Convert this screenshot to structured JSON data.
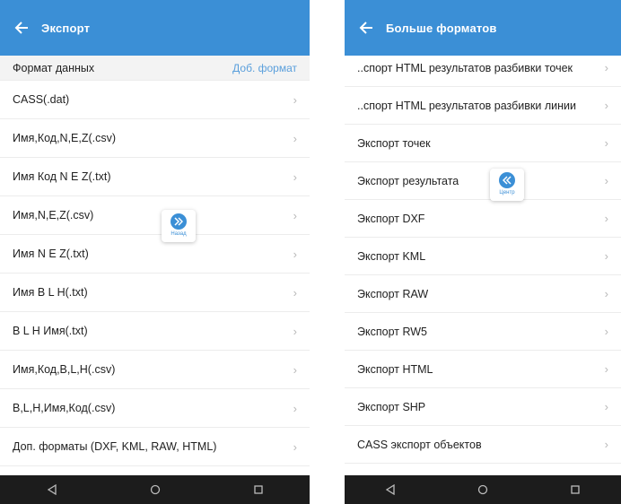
{
  "left": {
    "title": "Экспорт",
    "header": {
      "label": "Формат данных",
      "link": "Доб. формат"
    },
    "items": [
      "CASS(.dat)",
      "Имя,Код,N,E,Z(.csv)",
      "Имя Код N E Z(.txt)",
      "Имя,N,E,Z(.csv)",
      "Имя N E Z(.txt)",
      "Имя B L H(.txt)",
      "B L H Имя(.txt)",
      "Имя,Код,B,L,H(.csv)",
      "B,L,H,Имя,Код(.csv)",
      "Доп. форматы (DXF, KML, RAW, HTML)"
    ],
    "float_caption": "Назад"
  },
  "right": {
    "title": "Больше форматов",
    "items": [
      "..спорт HTML результатов разбивки точек",
      "..спорт HTML результатов разбивки линии",
      "Экспорт точек",
      "Экспорт результата",
      "Экспорт DXF",
      "Экспорт KML",
      "Экспорт RAW",
      "Экспорт RW5",
      "Экспорт HTML",
      "Экспорт SHP",
      "CASS экспорт объектов"
    ],
    "float_caption": "Центр"
  },
  "chevron": "›",
  "colors": {
    "appbar": "#3b8fd6",
    "navbar": "#1c1c1c",
    "link": "#5a9fdc"
  }
}
